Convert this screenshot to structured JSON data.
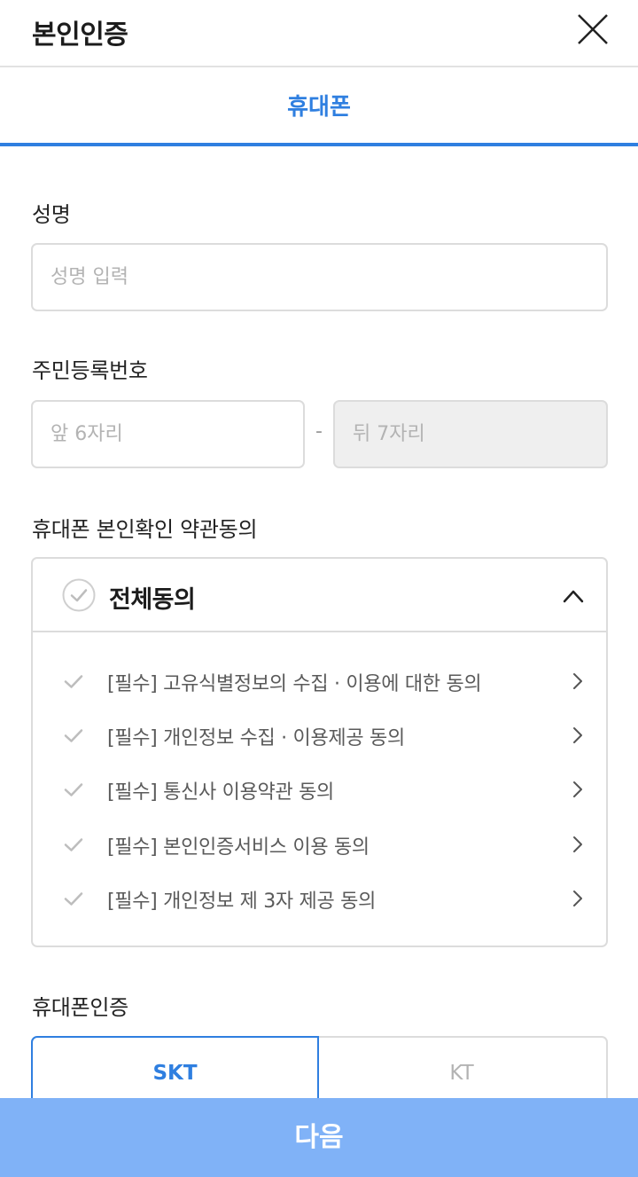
{
  "header": {
    "title": "본인인증",
    "close_icon": "close-icon"
  },
  "tabs": [
    {
      "label": "휴대폰",
      "active": true
    }
  ],
  "form": {
    "name": {
      "label": "성명",
      "placeholder": "성명 입력",
      "value": ""
    },
    "rrn": {
      "label": "주민등록번호",
      "front_placeholder": "앞 6자리",
      "back_placeholder": "뒤 7자리",
      "separator": "-"
    }
  },
  "terms": {
    "label": "휴대폰 본인확인 약관동의",
    "all_agree": "전체동의",
    "expanded": true,
    "items": [
      {
        "label": "[필수] 고유식별정보의 수집 · 이용에 대한 동의"
      },
      {
        "label": "[필수] 개인정보 수집 · 이용제공 동의"
      },
      {
        "label": "[필수] 통신사 이용약관 동의"
      },
      {
        "label": "[필수] 본인인증서비스 이용 동의"
      },
      {
        "label": "[필수] 개인정보 제 3자 제공 동의"
      }
    ]
  },
  "carrier": {
    "label": "휴대폰인증",
    "options": [
      {
        "label": "SKT",
        "selected": true
      },
      {
        "label": "KT",
        "selected": false
      }
    ]
  },
  "footer": {
    "next_label": "다음"
  },
  "colors": {
    "accent": "#2f7fe0",
    "button": "#80b2f7",
    "border": "#dcdcdc",
    "disabled_bg": "#efefef"
  }
}
